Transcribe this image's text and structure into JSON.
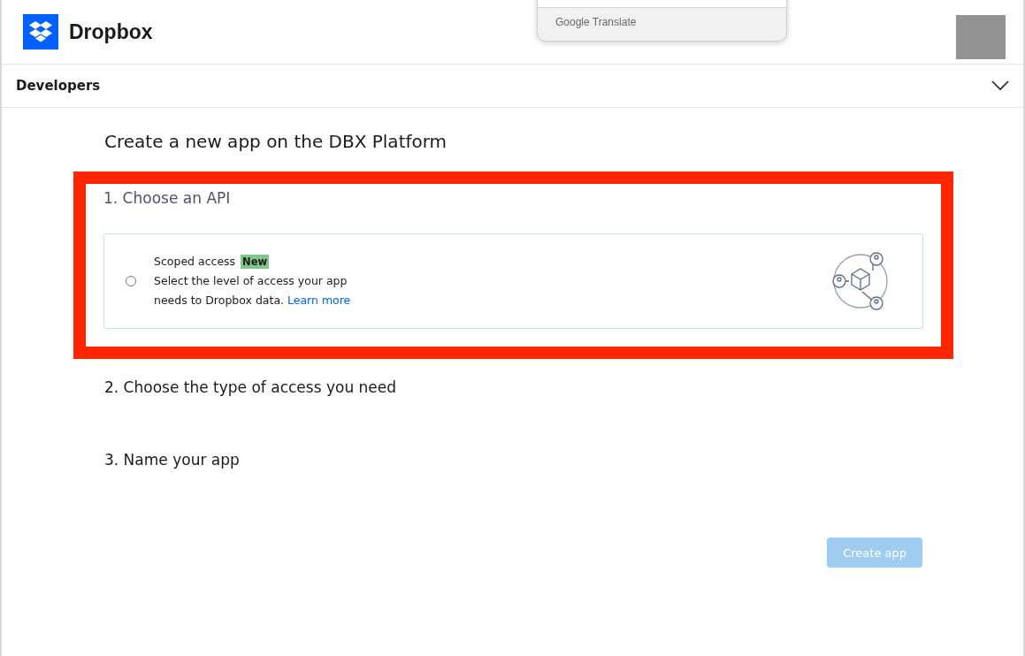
{
  "header": {
    "logo_text": "Dropbox"
  },
  "translate_popup": {
    "label": "Google Translate"
  },
  "nav": {
    "title": "Developers",
    "expanded": false
  },
  "page_title": "Create a new app on the DBX Platform",
  "steps": [
    {
      "title": "1. Choose an API",
      "highlighted": true,
      "options": [
        {
          "label": "Scoped access",
          "badge": "New",
          "description": "Select the level of access your app needs to Dropbox data.",
          "link": "Learn more",
          "selected": false
        }
      ]
    },
    {
      "title": "2. Choose the type of access you need",
      "highlighted": false
    },
    {
      "title": "3. Name your app",
      "highlighted": false
    }
  ],
  "submit": {
    "label": "Create app",
    "disabled": true
  }
}
